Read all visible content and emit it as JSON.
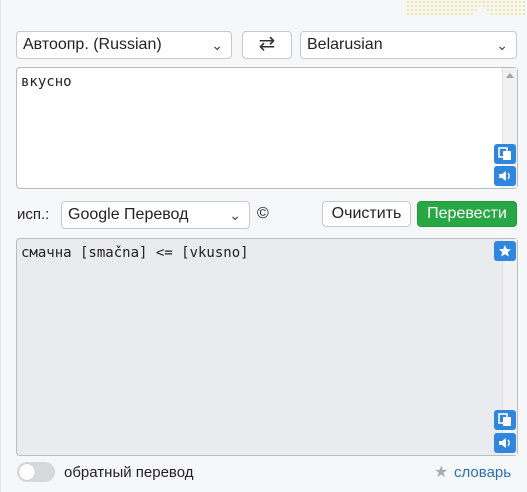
{
  "source_language": {
    "selected": "Автоопр. (Russian)"
  },
  "target_language": {
    "selected": "Belarusian"
  },
  "swap_icon": "⇄",
  "input": {
    "text": "вкусно"
  },
  "engine": {
    "label": "исп.:",
    "selected": "Google Перевод",
    "copyright": "©"
  },
  "buttons": {
    "clear": "Очистить",
    "translate": "Перевести"
  },
  "output": {
    "text": "смачна [smačna] <= [vkusno]"
  },
  "footer": {
    "reverse_label": "обратный перевод",
    "dictionary_label": "словарь",
    "reverse_enabled": false
  },
  "icons": {
    "copy": "copy-icon",
    "speaker": "speaker-icon",
    "star": "star-icon",
    "swap": "swap-icon"
  },
  "colors": {
    "accent_blue": "#2e86de",
    "translate_green": "#28a745",
    "dictionary_link": "#2a6fb8"
  }
}
